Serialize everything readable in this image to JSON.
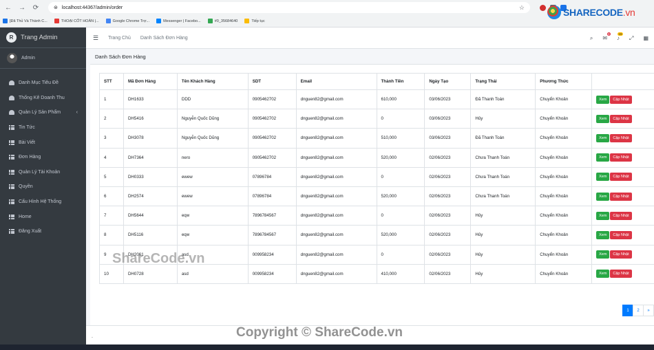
{
  "browser": {
    "url": "localhost:44367/admin/order",
    "bookmarks": [
      "[Đã Thủ Và Thành C...",
      "THOẠI CỐT HOÀN |...",
      "Google Chrome Trợ...",
      "Messenger | Facebo...",
      "#0_35684640",
      "Tiếp tục"
    ]
  },
  "sidebar": {
    "brand": "Trang Admin",
    "brand_logo": "R",
    "user": "Admin",
    "items": [
      {
        "label": "Danh Mục Tiêu Đề",
        "icon": "gauge-icon"
      },
      {
        "label": "Thống Kê Doanh Thu",
        "icon": "gauge-icon"
      },
      {
        "label": "Quản Lý Sản Phẩm",
        "icon": "gauge-icon",
        "chevron": "‹"
      },
      {
        "label": "Tin Tức",
        "icon": "grid-icon"
      },
      {
        "label": "Bài Viết",
        "icon": "grid-icon"
      },
      {
        "label": "Đơn Hàng",
        "icon": "grid-icon"
      },
      {
        "label": "Quản Lý Tài Khoản",
        "icon": "grid-icon"
      },
      {
        "label": "Quyền",
        "icon": "grid-icon"
      },
      {
        "label": "Cấu Hình Hệ Thống",
        "icon": "grid-icon"
      },
      {
        "label": "Home",
        "icon": "grid-icon"
      },
      {
        "label": "Đăng Xuất",
        "icon": "grid-icon"
      }
    ]
  },
  "navbar": {
    "links": [
      "Trang Chủ",
      "Danh Sách Đơn Hàng"
    ],
    "message_badge": "3",
    "notification_badge": "15"
  },
  "page": {
    "title": "Danh Sách Đơn Hàng",
    "columns": [
      "STT",
      "Mã Đơn Hàng",
      "Tên Khách Hàng",
      "SDT",
      "Email",
      "Thành Tiền",
      "Ngày Tạo",
      "Trạng Thái",
      "Phương Thức",
      ""
    ],
    "rows": [
      [
        "1",
        "DH1633",
        "DDD",
        "0905462702",
        "dnguen82@gmail.com",
        "610,000",
        "03/06/2023",
        "Đã Thanh Toán",
        "Chuyển Khoản"
      ],
      [
        "2",
        "DH5416",
        "Nguyễn Quốc Dũng",
        "0905462702",
        "dnguen82@gmail.com",
        "0",
        "03/06/2023",
        "Hủy",
        "Chuyển Khoản"
      ],
      [
        "3",
        "DH3078",
        "Nguyễn Quốc Dũng",
        "0905462702",
        "dnguen82@gmail.com",
        "510,000",
        "03/06/2023",
        "Đã Thanh Toán",
        "Chuyển Khoản"
      ],
      [
        "4",
        "DH7364",
        "nero",
        "0905462702",
        "dnguen82@gmail.com",
        "520,000",
        "02/06/2023",
        "Chưa Thanh Toán",
        "Chuyển Khoản"
      ],
      [
        "5",
        "DH0333",
        "ewew",
        "07896784",
        "dnguen82@gmail.com",
        "0",
        "02/06/2023",
        "Chưa Thanh Toán",
        "Chuyển Khoản"
      ],
      [
        "6",
        "DH2574",
        "ewew",
        "07896784",
        "dnguen82@gmail.com",
        "520,000",
        "02/06/2023",
        "Chưa Thanh Toán",
        "Chuyển Khoản"
      ],
      [
        "7",
        "DH5644",
        "eqw",
        "7896784567",
        "dnguen82@gmail.com",
        "0",
        "02/06/2023",
        "Hủy",
        "Chuyển Khoản"
      ],
      [
        "8",
        "DH5116",
        "eqw",
        "7896784567",
        "dnguen82@gmail.com",
        "520,000",
        "02/06/2023",
        "Hủy",
        "Chuyển Khoản"
      ],
      [
        "9",
        "DH2061",
        "asd",
        "009958234",
        "dnguen82@gmail.com",
        "0",
        "02/06/2023",
        "Hủy",
        "Chuyển Khoản"
      ],
      [
        "10",
        "DH0728",
        "asd",
        "009958234",
        "dnguen82@gmail.com",
        "410,000",
        "02/06/2023",
        "Hủy",
        "Chuyển Khoản"
      ]
    ],
    "view_label": "Xem",
    "update_label": "Cập Nhật",
    "pagination": [
      "1",
      "2",
      "»"
    ],
    "active_page": "1"
  },
  "footer": {
    "text": "."
  },
  "watermarks": {
    "logo_main": "SHARECODE",
    "logo_suffix": ".vn",
    "middle": "ShareCode.vn",
    "bottom": "Copyright © ShareCode.vn"
  },
  "colors": {
    "sidebar": "#343a40",
    "primary": "#007bff",
    "success": "#28a745",
    "danger": "#dc3545"
  }
}
